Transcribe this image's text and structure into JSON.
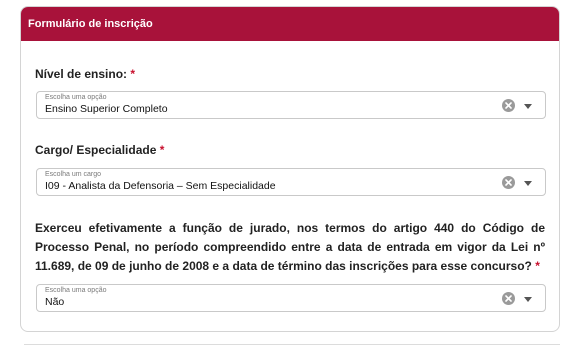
{
  "form": {
    "header_title": "Formulário de inscrição",
    "required_mark": "*",
    "education": {
      "label": "Nível de ensino:",
      "hint": "Escolha uma opção",
      "value": "Ensino Superior Completo"
    },
    "position": {
      "label": "Cargo/ Especialidade",
      "hint": "Escolha um cargo",
      "value": "I09 - Analista da Defensoria – Sem Especialidade"
    },
    "juror": {
      "question": "Exerceu efetivamente a função de jurado, nos termos do artigo 440 do Código de Processo Penal, no período compreendido entre a data de entrada em vigor da Lei nº 11.689, de 09 de junho de 2008 e a data de término das inscrições para esse concurso?",
      "hint": "Escolha uma opção",
      "value": "Não"
    }
  },
  "colors": {
    "header_bg": "#a8123a",
    "required": "#c8102e"
  },
  "icons": {
    "clear": "clear-icon",
    "dropdown": "chevron-down-icon"
  }
}
